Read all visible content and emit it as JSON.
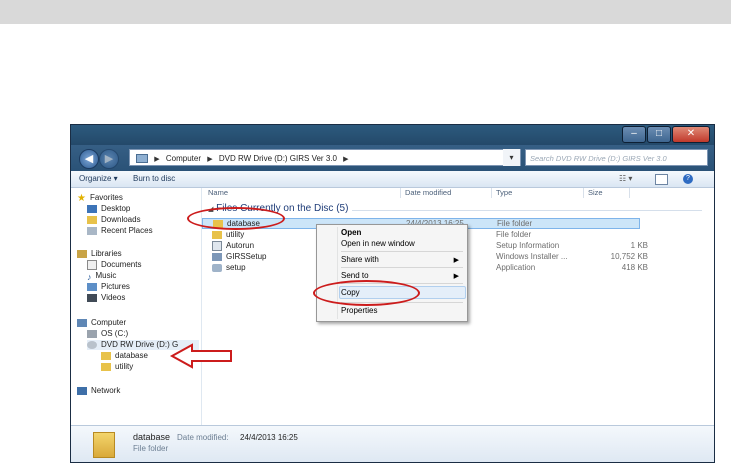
{
  "window": {
    "address": {
      "segments": [
        "Computer",
        "DVD RW Drive (D:) GIRS Ver 3.0"
      ],
      "search_placeholder": "Search DVD RW Drive (D:) GIRS Ver 3.0"
    },
    "toolbar": {
      "organize": "Organize ▾",
      "burn": "Burn to disc"
    },
    "sidebar": {
      "favorites": "Favorites",
      "favorite_items": [
        "Desktop",
        "Downloads",
        "Recent Places"
      ],
      "libraries": "Libraries",
      "library_items": [
        "Documents",
        "Music",
        "Pictures",
        "Videos"
      ],
      "computer": "Computer",
      "os": "OS (C:)",
      "dvd": "DVD RW Drive (D:) G",
      "dvd_children": [
        "database",
        "utility"
      ],
      "network": "Network"
    },
    "columns": {
      "name": "Name",
      "date": "Date modified",
      "type": "Type",
      "size": "Size"
    },
    "group_header": "Files Currently on the Disc (5)",
    "files": [
      {
        "name": "database",
        "date": "24/4/2013 16:25",
        "type": "File folder",
        "size": ""
      },
      {
        "name": "utility",
        "date": "",
        "type": "File folder",
        "size": ""
      },
      {
        "name": "Autorun",
        "date": "",
        "type": "Setup Information",
        "size": "1 KB"
      },
      {
        "name": "GIRSSetup",
        "date": "",
        "type": "Windows Installer ...",
        "size": "10,752 KB"
      },
      {
        "name": "setup",
        "date": "",
        "type": "Application",
        "size": "418 KB"
      }
    ],
    "context_menu": {
      "open": "Open",
      "open_new_window": "Open in new window",
      "share_with": "Share with",
      "send_to": "Send to",
      "copy": "Copy",
      "properties": "Properties"
    },
    "status": {
      "name": "database",
      "date_label": "Date modified:",
      "date_value": "24/4/2013 16:25",
      "type": "File folder"
    }
  },
  "colors": {
    "annotation": "#cc1c1c",
    "selection": "#cce5f8",
    "chrome": "#2a5277"
  }
}
